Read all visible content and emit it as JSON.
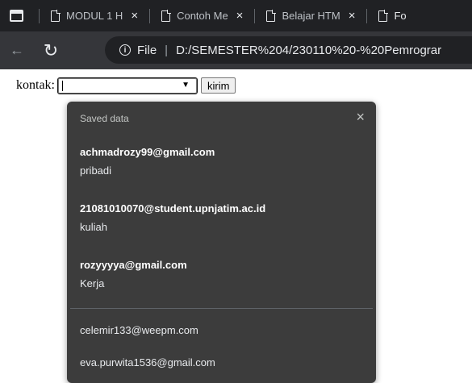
{
  "tabs": [
    {
      "title": "MODUL 1 H",
      "close": "×"
    },
    {
      "title": "Contoh Me",
      "close": "×"
    },
    {
      "title": "Belajar HTM",
      "close": "×"
    },
    {
      "title": "Fo"
    }
  ],
  "navbar": {
    "back_icon": "←",
    "reload_icon": "↻",
    "info_glyph": "i",
    "scheme": "File",
    "separator": "|",
    "url": "D:/SEMESTER%204/230110%20-%20Pemrograr"
  },
  "form": {
    "label": "kontak:",
    "input_value": "",
    "dropdown_arrow": "▼",
    "submit_label": "kirim"
  },
  "autofill": {
    "header": "Saved data",
    "close": "×",
    "suggestions": [
      {
        "email": "achmadrozy99@gmail.com",
        "label": "pribadi"
      },
      {
        "email": "21081010070@student.upnjatim.ac.id",
        "label": "kuliah"
      },
      {
        "email": "rozyyyya@gmail.com",
        "label": "Kerja"
      }
    ],
    "plain": [
      "celemir133@weepm.com",
      "eva.purwita1536@gmail.com"
    ]
  },
  "colors": {
    "tabbar_bg": "#202124",
    "navbar_bg": "#35363a",
    "popup_bg": "#3c3c3c"
  }
}
